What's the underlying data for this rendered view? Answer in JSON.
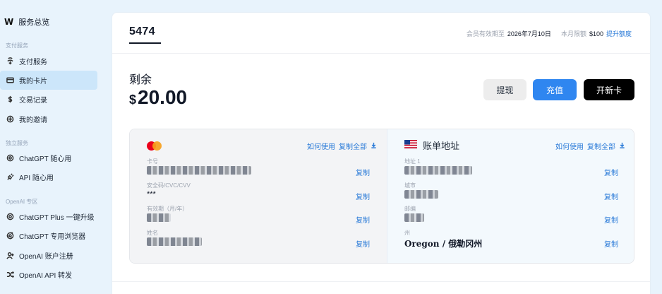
{
  "sidebar": {
    "brand": {
      "logo": "W",
      "label": "服务总览"
    },
    "sections": [
      {
        "title": "支付服务",
        "items": [
          {
            "label": "支付服务",
            "icon": "wallet-icon",
            "active": false
          },
          {
            "label": "我的卡片",
            "icon": "card-icon",
            "active": true
          },
          {
            "label": "交易记录",
            "icon": "dollar-icon",
            "active": false
          },
          {
            "label": "我的邀请",
            "icon": "share-icon",
            "active": false
          }
        ]
      },
      {
        "title": "独立服务",
        "items": [
          {
            "label": "ChatGPT 随心用",
            "icon": "openai-icon",
            "active": false
          },
          {
            "label": "API 随心用",
            "icon": "plug-icon",
            "active": false
          }
        ]
      },
      {
        "title": "OpenAI 专区",
        "items": [
          {
            "label": "ChatGPT Plus 一键升级",
            "icon": "openai-icon",
            "active": false
          },
          {
            "label": "ChatGPT 专用浏览器",
            "icon": "chrome-icon",
            "active": false
          },
          {
            "label": "OpenAI 账户注册",
            "icon": "user-add-icon",
            "active": false
          },
          {
            "label": "OpenAI API 转发",
            "icon": "shuffle-icon",
            "active": false
          }
        ]
      }
    ]
  },
  "header": {
    "card_tab": "5474",
    "membership_label": "会员有效期至",
    "membership_date": "2026年7月10日",
    "limit_label": "本月限额",
    "limit_value": "$100",
    "raise_limit_link": "提升额度"
  },
  "balance": {
    "label": "剩余",
    "currency": "$",
    "amount": "20.00"
  },
  "actions": {
    "withdraw": "提现",
    "topup": "充值",
    "new_card": "开新卡"
  },
  "card_details": {
    "how_to_use": "如何使用",
    "copy_all": "复制全部",
    "copy": "复制",
    "fields": [
      {
        "label": "卡号",
        "value": ""
      },
      {
        "label": "安全码/CVC/CVV",
        "value": "***"
      },
      {
        "label": "有效期（月/年）",
        "value": ""
      },
      {
        "label": "姓名",
        "value": ""
      }
    ]
  },
  "billing_address": {
    "title": "账单地址",
    "how_to_use": "如何使用",
    "copy_all": "复制全部",
    "copy": "复制",
    "fields": [
      {
        "label": "地址 1",
        "value": ""
      },
      {
        "label": "城市",
        "value": ""
      },
      {
        "label": "邮编",
        "value": ""
      },
      {
        "label": "州",
        "value": "Oregon / 俄勒冈州"
      }
    ]
  },
  "colors": {
    "accent": "#2f86f0",
    "link": "#2b7bd8",
    "active_nav": "#cce6fa",
    "background": "#e8f3fc"
  }
}
